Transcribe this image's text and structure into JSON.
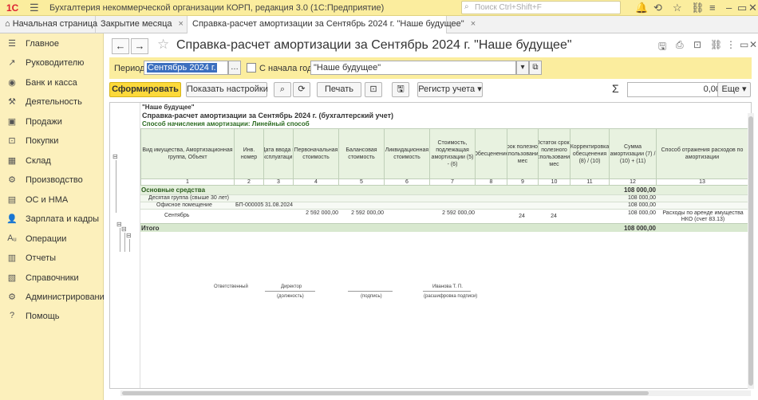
{
  "titlebar": {
    "logo": "1С",
    "app_title": "Бухгалтерия некоммерческой организации КОРП, редакция 3.0  (1С:Предприятие)",
    "search_placeholder": "Поиск Ctrl+Shift+F",
    "icons": [
      "bell-icon",
      "history-icon",
      "star-icon",
      "link-icon",
      "menu-icon",
      "minimize-icon",
      "maximize-icon",
      "close-icon"
    ]
  },
  "tabs": [
    {
      "label": "Начальная страница",
      "icon": "home-icon"
    },
    {
      "label": "Закрытие месяца"
    },
    {
      "label": "Справка-расчет амортизации за Сентябрь 2024 г. \"Наше будущее\""
    }
  ],
  "sidebar": {
    "items": [
      {
        "label": "Главное",
        "icon": "menu-icon"
      },
      {
        "label": "Руководителю",
        "icon": "chart-icon"
      },
      {
        "label": "Банк и касса",
        "icon": "bank-icon"
      },
      {
        "label": "Деятельность",
        "icon": "activity-icon"
      },
      {
        "label": "Продажи",
        "icon": "cart-icon"
      },
      {
        "label": "Покупки",
        "icon": "basket-icon"
      },
      {
        "label": "Склад",
        "icon": "warehouse-icon"
      },
      {
        "label": "Производство",
        "icon": "production-icon"
      },
      {
        "label": "ОС и НМА",
        "icon": "assets-icon"
      },
      {
        "label": "Зарплата и кадры",
        "icon": "people-icon"
      },
      {
        "label": "Операции",
        "icon": "operations-icon"
      },
      {
        "label": "Отчеты",
        "icon": "reports-icon"
      },
      {
        "label": "Справочники",
        "icon": "book-icon"
      },
      {
        "label": "Администрирование",
        "icon": "gear-icon"
      },
      {
        "label": "Помощь",
        "icon": "help-icon"
      }
    ]
  },
  "document": {
    "title": "Справка-расчет амортизации за Сентябрь 2024 г. \"Наше будущее\"",
    "filter": {
      "period_label": "Период:",
      "period_value": "Сентябрь 2024 г.",
      "from_start_label": "С начала года",
      "org_value": "\"Наше будущее\""
    },
    "buttons": {
      "generate": "Сформировать",
      "show_settings": "Показать настройки",
      "print": "Печать",
      "register": "Регистр учета",
      "more": "Еще",
      "sum_symbol": "Σ",
      "sum_value": "0,00"
    }
  },
  "report": {
    "org": "\"Наше будущее\"",
    "title": "Справка-расчет амортизации за Сентябрь 2024 г. (бухгалтерский учет)",
    "method": "Способ начисления амортизации: Линейный способ",
    "headers": [
      "Вид имущества, Амортизационная группа, Объект",
      "Инв. номер",
      "Дата ввода в эксплуатацию",
      "Первоначальная стоимость",
      "Балансовая стоимость",
      "Ликвидационная стоимость",
      "Стоимость, подлежащая амортизации (5) - (6)",
      "Обесценение",
      "Срок полезного использования, мес",
      "Остаток срока полезного использования, мес",
      "Корректировка обесценения (8) / (10)",
      "Сумма амортизации (7) / (10) + (11)",
      "Способ отражения расходов по амортизации"
    ],
    "header_numbers": [
      "1",
      "2",
      "3",
      "4",
      "5",
      "6",
      "7",
      "8",
      "9",
      "10",
      "11",
      "12",
      "13"
    ],
    "rows": [
      {
        "type": "group",
        "name": "Основные средства",
        "sum": "108 000,00"
      },
      {
        "type": "sub",
        "name": "Десятая группа (свыше 30 лет)",
        "sum": "108 000,00"
      },
      {
        "type": "sub2",
        "name": "Офисное помещение",
        "inv": "БП-000005",
        "date": "31.08.2024",
        "sum": "108 000,00"
      },
      {
        "type": "detail",
        "name": "Сентябрь",
        "initial": "2 592 000,00",
        "balance": "2 592 000,00",
        "amort_base": "2 592 000,00",
        "life": "24",
        "remaining": "24",
        "sum": "108 000,00",
        "method": "Расходы по аренде имущества НКО (счет 83.13)"
      },
      {
        "type": "total",
        "name": "Итого",
        "sum": "108 000,00"
      }
    ],
    "signature": {
      "responsible": "Ответственный",
      "position_value": "Директор",
      "position_caption": "(должность)",
      "signature_caption": "(подпись)",
      "name_value": "Иванова Т. П.",
      "name_caption": "(расшифровка подписи)"
    }
  }
}
